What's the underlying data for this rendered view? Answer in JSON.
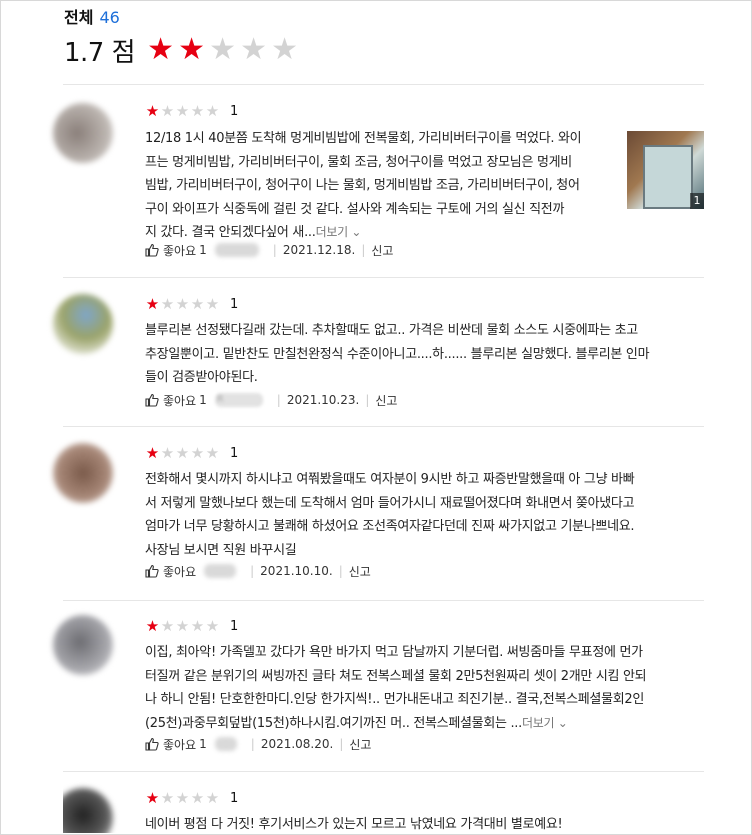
{
  "summary": {
    "label": "전체",
    "count": "46"
  },
  "score": {
    "value": "1.7 점",
    "stars_filled": 2,
    "stars_total": 5
  },
  "colors": {
    "star_on": "#e60012",
    "star_off": "#d3d3d3",
    "count_blue": "#1e6fd9"
  },
  "icons": {
    "like": "thumbs-up-icon",
    "more": "chevron-down-icon"
  },
  "reviews": [
    {
      "rating": "1",
      "lines": [
        "12/18 1시 40분쯤 도착해 멍게비빔밥에 전복물회, 가리비버터구이를 먹었다. 와이",
        "프는 멍게비빔밥, 가리비버터구이, 물회 조금, 청어구이를 먹었고 장모님은 멍게비",
        "빔밥, 가리비버터구이, 청어구이 나는 물회, 멍게비빔밥 조금, 가리비버터구이, 청어",
        "구이 와이프가 식중독에 걸린 것 같다. 설사와 계속되는 구토에 거의 실신 직전까",
        "지 갔다.  결국 안되겠다싶어 새..."
      ],
      "more_label": "더보기",
      "photo_count": "1",
      "likes_label": "좋아요",
      "likes": "1",
      "date": "2021.12.18.",
      "report_label": "신고"
    },
    {
      "rating": "1",
      "lines": [
        "블루리본 선정됐다길래 갔는데. 추차할때도 없고.. 가격은 비싼데 물회 소스도 시중에파는 초고",
        "추장일뿐이고. 밑반찬도 만칠천완정식 수준이아니고....하...... 블루리본 실망했다. 블루리본 인마",
        "들이 검증받아야된다."
      ],
      "likes_label": "좋아요",
      "likes": "1",
      "author_initial": "R",
      "date": "2021.10.23.",
      "report_label": "신고"
    },
    {
      "rating": "1",
      "lines": [
        "전화해서 몇시까지 하시냐고 여쭤봤을때도 여자분이 9시반 하고 짜증반말했을때 아 그냥 바빠",
        "서 저렇게 말했나보다 했는데 도착해서 엄마 들어가시니 재료떨어졌다며 화내면서 쫒아냈다고",
        "엄마가 너무 당황하시고 불쾌해 하셨어요 조선족여자같다던데 진짜 싸가지없고 기분나쁘네요.",
        "사장님 보시면 직원 바꾸시길"
      ],
      "likes_label": "좋아요",
      "likes": "",
      "date": "2021.10.10.",
      "report_label": "신고"
    },
    {
      "rating": "1",
      "lines": [
        "이집, 최아악! 가족델꼬 갔다가 욕만 바가지 먹고 담날까지 기분더럽. 써빙줌마들 무표정에 먼가",
        "터질꺼 같은 분위기의 써빙까진 글타 쳐도 전복스페셜 물회 2만5천원짜리 셋이 2개만 시킴 안되",
        "나 하니 안됨! 단호한한마디.인당 한가지씩!.. 먼가내돈내고 죄진기분.. 결국,전복스페셜물회2인",
        "(25천)과중무회덮밥(15천)하나시킴.여기까진 머.. 전복스페셜물회는 ..."
      ],
      "more_label": "더보기",
      "likes_label": "좋아요",
      "likes": "1",
      "date": "2021.08.20.",
      "report_label": "신고"
    },
    {
      "rating": "1",
      "lines": [
        "네이버 평점 다 거짓! 후기서비스가 있는지 모르고 낚였네요 가격대비 별로예요!"
      ]
    }
  ]
}
